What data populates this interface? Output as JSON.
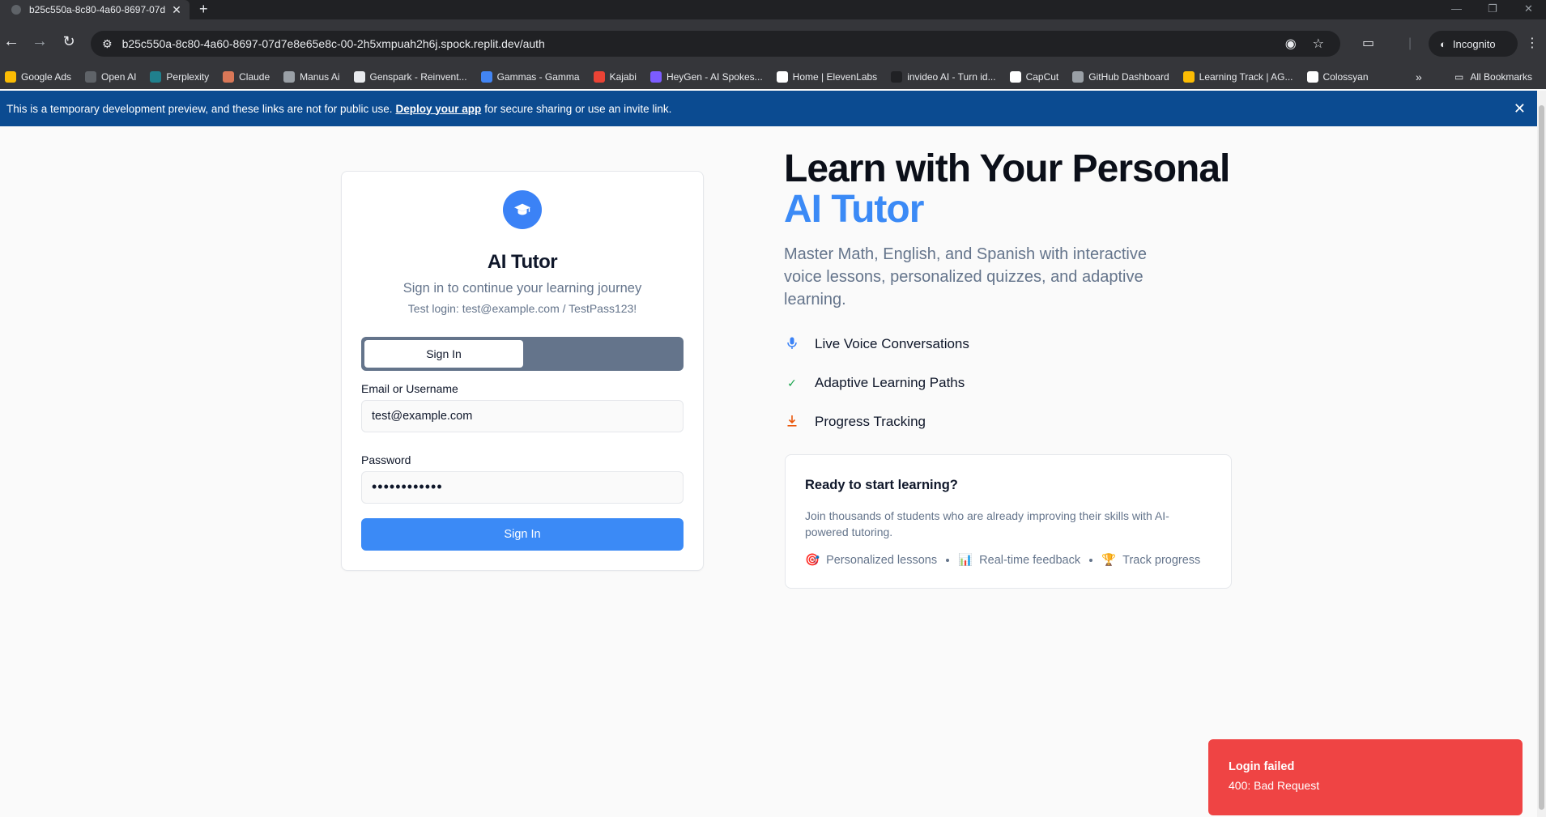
{
  "browser": {
    "tab_title": "b25c550a-8c80-4a60-8697-07d",
    "url": "b25c550a-8c80-4a60-8697-07d7e8e65e8c-00-2h5xmpuah2h6j.spock.replit.dev/auth",
    "incognito_label": "Incognito",
    "bookmarks": [
      {
        "label": "Google Ads",
        "color": "#fbbc04"
      },
      {
        "label": "Open AI",
        "color": "#5f6368"
      },
      {
        "label": "Perplexity",
        "color": "#20808d"
      },
      {
        "label": "Claude",
        "color": "#d97757"
      },
      {
        "label": "Manus Ai",
        "color": "#9aa0a6"
      },
      {
        "label": "Genspark - Reinvent...",
        "color": "#e8eaed"
      },
      {
        "label": "Gammas - Gamma",
        "color": "#4285f4"
      },
      {
        "label": "Kajabi",
        "color": "#ea4335"
      },
      {
        "label": "HeyGen - AI Spokes...",
        "color": "#7c5cff"
      },
      {
        "label": "Home | ElevenLabs",
        "color": "#ffffff"
      },
      {
        "label": "invideo AI - Turn id...",
        "color": "#202124"
      },
      {
        "label": "CapCut",
        "color": "#ffffff"
      },
      {
        "label": "GitHub Dashboard",
        "color": "#9aa0a6"
      },
      {
        "label": "Learning Track | AG...",
        "color": "#fbbc04"
      },
      {
        "label": "Colossyan",
        "color": "#ffffff"
      }
    ],
    "all_bookmarks_label": "All Bookmarks"
  },
  "banner": {
    "text_before": "This is a temporary development preview, and these links are not for public use.",
    "link_label": "Deploy your app",
    "text_after": "for secure sharing or use an invite link."
  },
  "auth": {
    "app_title": "AI Tutor",
    "subtitle": "Sign in to continue your learning journey",
    "test_hint": "Test login: test@example.com / TestPass123!",
    "tab_signin": "Sign In",
    "email_label": "Email or Username",
    "email_value": "test@example.com",
    "password_label": "Password",
    "password_value": "••••••••••••",
    "submit_label": "Sign In"
  },
  "hero": {
    "title_line1": "Learn with Your Personal",
    "title_line2": "AI Tutor",
    "description": "Master Math, English, and Spanish with interactive voice lessons, personalized quizzes, and adaptive learning.",
    "features": [
      {
        "label": "Live Voice Conversations",
        "icon": "microphone-icon",
        "color": "#3b82f6"
      },
      {
        "label": "Adaptive Learning Paths",
        "icon": "check-icon",
        "color": "#16a34a"
      },
      {
        "label": "Progress Tracking",
        "icon": "download-icon",
        "color": "#ea580c"
      }
    ],
    "cta": {
      "title": "Ready to start learning?",
      "text": "Join thousands of students who are already improving their skills with AI-powered tutoring.",
      "tags": [
        {
          "emoji": "🎯",
          "label": "Personalized lessons"
        },
        {
          "emoji": "📊",
          "label": "Real-time feedback"
        },
        {
          "emoji": "🏆",
          "label": "Track progress"
        }
      ]
    }
  },
  "toast": {
    "title": "Login failed",
    "description": "400: Bad Request"
  },
  "colors": {
    "accent": "#3b8af6",
    "banner": "#0b4b91",
    "error": "#ef4444"
  }
}
